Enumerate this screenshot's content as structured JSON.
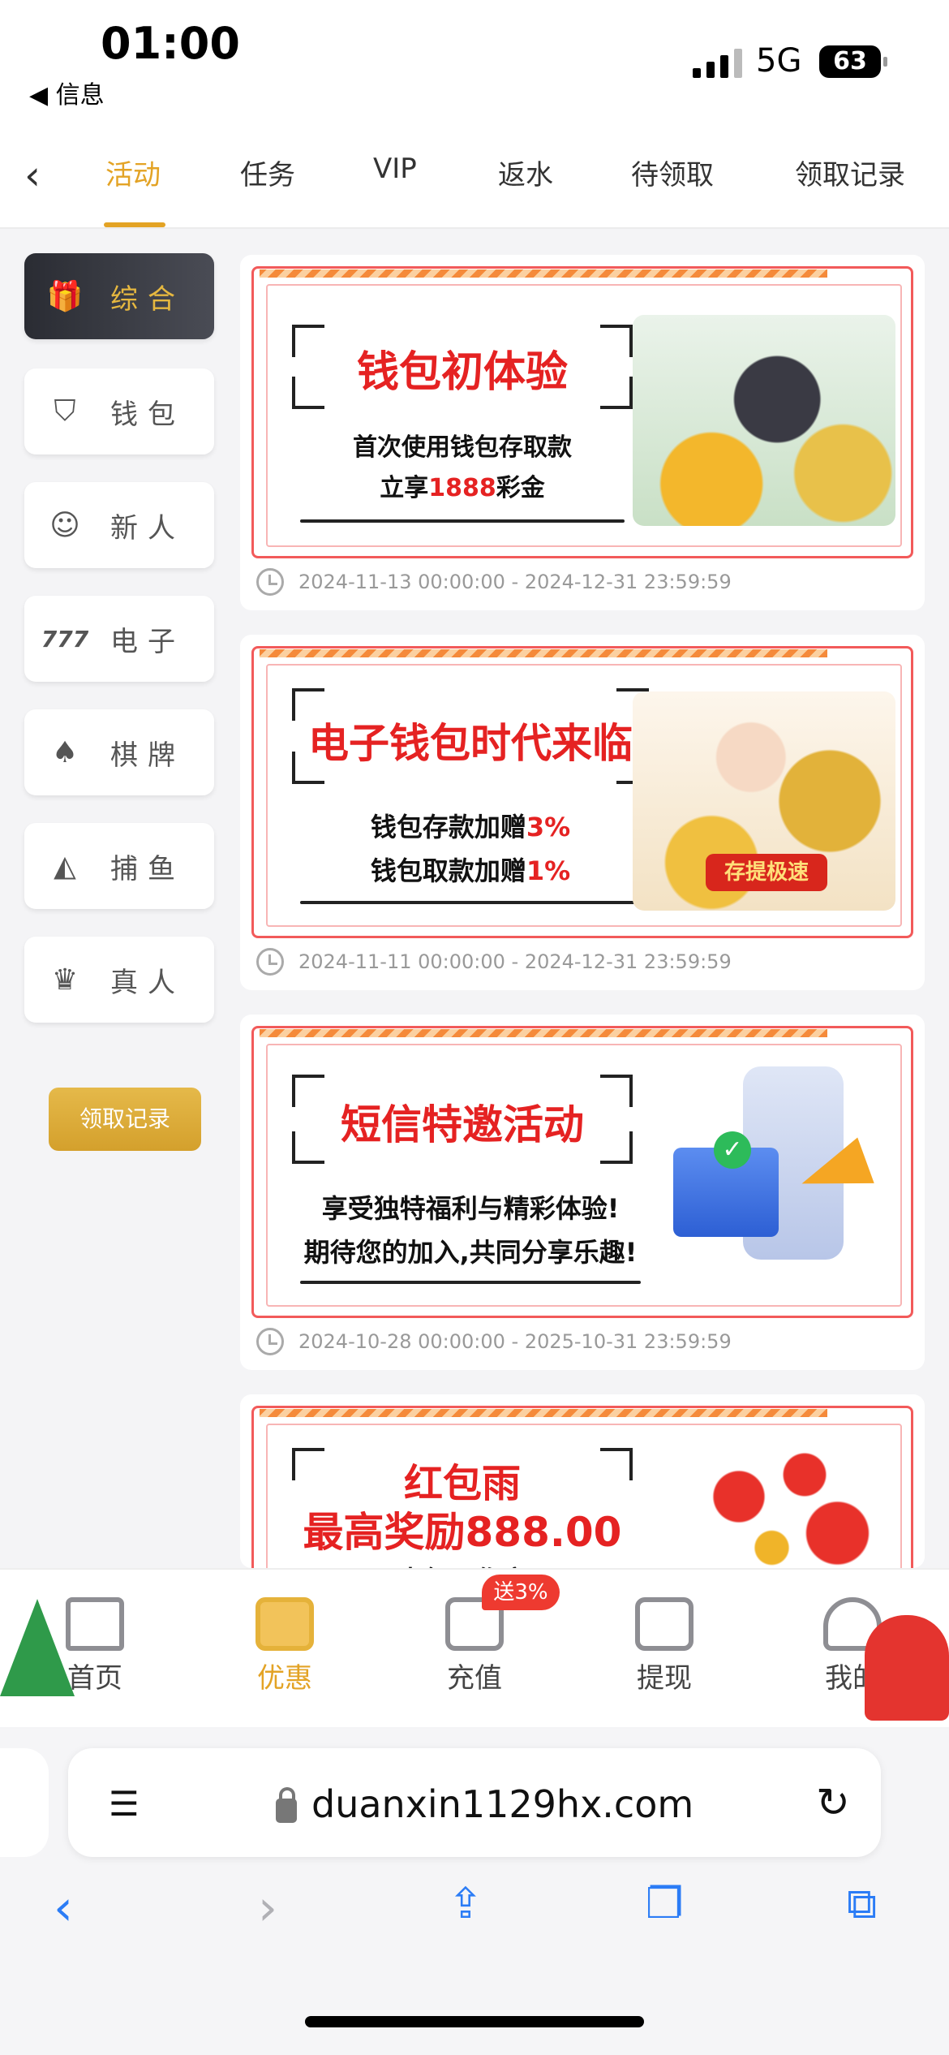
{
  "status": {
    "time": "01:00",
    "back_app": "◀ 信息",
    "network": "5G",
    "battery": "63"
  },
  "tabs": {
    "back_icon": "chevron-left-icon",
    "items": [
      "活动",
      "任务",
      "VIP",
      "返水",
      "待领取",
      "领取记录"
    ],
    "active": "活动"
  },
  "sidebar": {
    "items": [
      {
        "label": "综合",
        "icon": "gift-icon"
      },
      {
        "label": "钱包",
        "icon": "shield-star-icon"
      },
      {
        "label": "新人",
        "icon": "users-icon"
      },
      {
        "label": "电子",
        "icon": "slot-777-icon"
      },
      {
        "label": "棋牌",
        "icon": "cards-icon"
      },
      {
        "label": "捕鱼",
        "icon": "shark-icon"
      },
      {
        "label": "真人",
        "icon": "dealer-icon"
      }
    ],
    "claim_button": "领取记录"
  },
  "promos": [
    {
      "headline": "钱包初体验",
      "line1": "首次使用钱包存取款",
      "line2_pre": "立享",
      "line2_hl": "1888",
      "line2_post": "彩金",
      "date": "2024-11-13 00:00:00 - 2024-12-31 23:59:59"
    },
    {
      "headline": "电子钱包时代来临",
      "line1_pre": "钱包存款加赠",
      "line1_hl": "3%",
      "line2_pre": "钱包取款加赠",
      "line2_hl": "1%",
      "art_label": "存提极速",
      "date": "2024-11-11 00:00:00 - 2024-12-31 23:59:59"
    },
    {
      "headline": "短信特邀活动",
      "line1": "享受独特福利与精彩体验!",
      "line2": "期待您的加入,共同分享乐趣!",
      "date": "2024-10-28 00:00:00 - 2025-10-31 23:59:59"
    },
    {
      "headline_line1": "红包雨",
      "headline_line2": "最高奖励888.00",
      "line1": "未领取作废"
    }
  ],
  "bottom_nav": {
    "items": [
      {
        "label": "首页",
        "icon": "home-icon"
      },
      {
        "label": "优惠",
        "icon": "gift-icon"
      },
      {
        "label": "充值",
        "icon": "wallet-icon"
      },
      {
        "label": "提现",
        "icon": "cash-withdraw-icon"
      },
      {
        "label": "我的",
        "icon": "user-icon"
      }
    ],
    "active": "优惠",
    "recharge_badge": "送3%"
  },
  "browser": {
    "url": "duanxin1129hx.com",
    "reader_icon": "reader-icon",
    "reload_icon": "reload-icon",
    "toolbar": [
      "back-icon",
      "forward-icon",
      "share-icon",
      "bookmarks-icon",
      "tabs-icon"
    ]
  },
  "colors": {
    "accent": "#e3a325",
    "promo_red": "#e52222",
    "sidebar_active": "#2a2c33",
    "safari_blue": "#2b7cf6"
  }
}
